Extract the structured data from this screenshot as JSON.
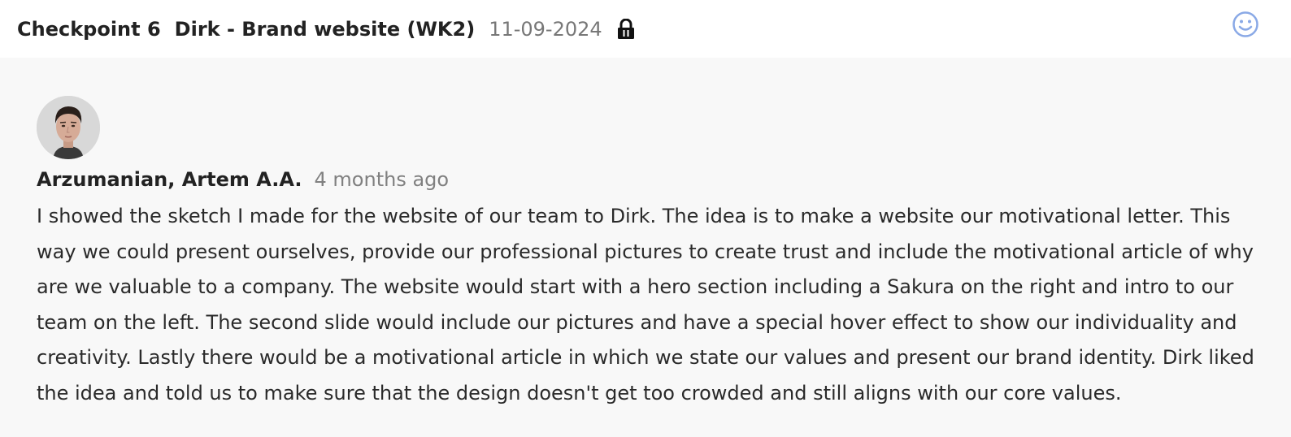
{
  "header": {
    "checkpoint_label": "Checkpoint 6",
    "title": "Dirk - Brand website (WK2)",
    "date": "11-09-2024",
    "lock_icon": "lock-icon",
    "feedback_icon": "smiley-icon"
  },
  "comment": {
    "avatar_icon": "avatar-photo",
    "author": "Arzumanian, Artem A.A.",
    "time_ago": "4 months ago",
    "body": "I showed the sketch I made for the website of our team to Dirk. The idea is to make a website our motivational letter. This way we could present ourselves, provide our professional pictures to create trust and include the motivational article of why are we valuable to a company. The website would start with a hero section including a Sakura on the right and intro to our team on the left. The second slide would include our pictures and have a special hover effect to show our individuality and creativity. Lastly there would be a motivational article in which we state our values and present our brand identity. Dirk liked the idea and told us to make sure that the design doesn't get too crowded and still aligns with our core values."
  },
  "colors": {
    "header_bg": "#ffffff",
    "page_bg": "#f8f8f8",
    "accent_icon": "#8aa9e6",
    "muted_text": "#808080"
  }
}
